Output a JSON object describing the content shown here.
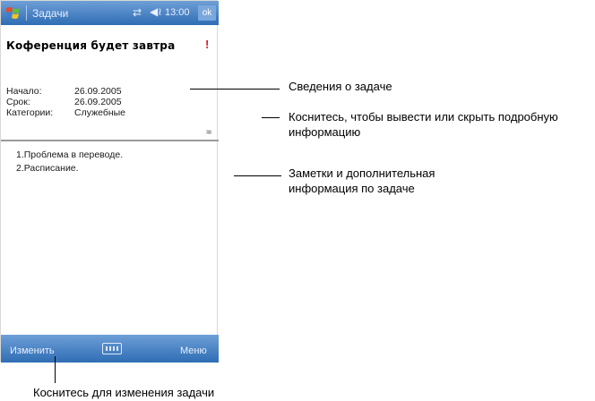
{
  "window": {
    "app_title": "Задачи",
    "clock": "13:00",
    "ok_label": "ok",
    "start_icon": "windows-flag-icon",
    "sync_icon": "connectivity-icon",
    "volume_icon": "speaker-icon",
    "accent_color": "#2f6db4"
  },
  "task": {
    "title": "Коференция будет завтра",
    "priority_mark": "!",
    "priority_color": "#d21f1f",
    "details": [
      {
        "label": "Начало:",
        "value": "26.09.2005"
      },
      {
        "label": "Срок:",
        "value": "26.09.2005"
      },
      {
        "label": "Категории:",
        "value": "Служебные"
      }
    ],
    "collapse_icon": "collapse-toggle-icon",
    "notes": [
      "1.Проблема в переводе.",
      "2.Расписание."
    ]
  },
  "menubar": {
    "edit_label": "Изменить",
    "menu_label": "Меню",
    "keyboard_icon": "keyboard-icon"
  },
  "callouts": {
    "task_info": "Сведения о задаче",
    "toggle_details": [
      "Коснитесь, чтобы вывести или скрыть подробную",
      "информацию"
    ],
    "notes_info": [
      "Заметки и дополнительная",
      "информация по задаче"
    ],
    "edit_task": "Коснитесь для изменения задачи"
  }
}
